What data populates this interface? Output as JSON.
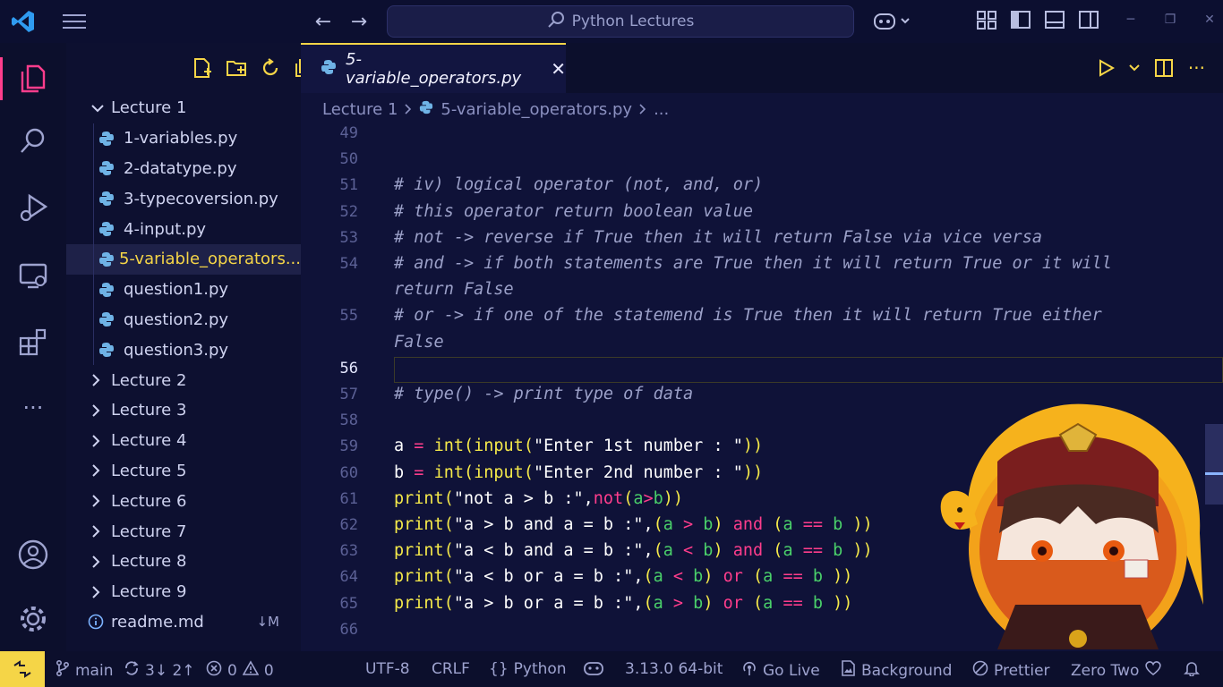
{
  "window": {
    "search_text": "Python Lectures"
  },
  "explorer": {
    "tree": [
      {
        "label": "Lecture 1",
        "kind": "folder",
        "open": true
      },
      {
        "label": "1-variables.py",
        "kind": "file"
      },
      {
        "label": "2-datatype.py",
        "kind": "file"
      },
      {
        "label": "3-typecoversion.py",
        "kind": "file"
      },
      {
        "label": "4-input.py",
        "kind": "file"
      },
      {
        "label": "5-variable_operators...",
        "kind": "file",
        "active": true
      },
      {
        "label": "question1.py",
        "kind": "file"
      },
      {
        "label": "question2.py",
        "kind": "file"
      },
      {
        "label": "question3.py",
        "kind": "file"
      },
      {
        "label": "Lecture 2",
        "kind": "folder"
      },
      {
        "label": "Lecture 3",
        "kind": "folder"
      },
      {
        "label": "Lecture 4",
        "kind": "folder"
      },
      {
        "label": "Lecture 5",
        "kind": "folder"
      },
      {
        "label": "Lecture 6",
        "kind": "folder"
      },
      {
        "label": "Lecture 7",
        "kind": "folder"
      },
      {
        "label": "Lecture 8",
        "kind": "folder"
      },
      {
        "label": "Lecture 9",
        "kind": "folder"
      },
      {
        "label": "readme.md",
        "kind": "readme",
        "badge": "↓M"
      }
    ]
  },
  "editor": {
    "tab_label": "5-variable_operators.py",
    "breadcrumb": [
      "Lecture 1",
      "5-variable_operators.py",
      "..."
    ],
    "line_numbers": [
      "49",
      "50",
      "51",
      "52",
      "53",
      "54",
      "",
      "55",
      "",
      "56",
      "57",
      "58",
      "59",
      "60",
      "61",
      "62",
      "63",
      "64",
      "65",
      "66"
    ],
    "comments": {
      "l51": "# iv) logical operator (not, and, or)",
      "l52": "# this operator return boolean value",
      "l53": "# not -> reverse if True then it will return False via vice versa",
      "l54a": "# and -> if both statements are True then it will return True or it will",
      "l54b": "return False",
      "l55a": "# or -> if one of the statemend is True then it will return True either",
      "l55b": "False",
      "l57": "# type() -> print type of data"
    },
    "strings": {
      "s59": "\"Enter 1st number : \"",
      "s60": "\"Enter 2nd number : \"",
      "s61": "\"not a > b :\"",
      "s62": "\"a > b and a = b :\"",
      "s63": "\"a < b and a = b :\"",
      "s64": "\"a < b or a = b :\"",
      "s65": "\"a > b or a = b :\""
    }
  },
  "statusbar": {
    "branch": "main",
    "sync": "3↓ 2↑",
    "errors": "0",
    "warnings": "0",
    "encoding": "UTF-8",
    "eol": "CRLF",
    "language": "Python",
    "interpreter": "3.13.0 64-bit",
    "golive": "Go Live",
    "background": "Background",
    "prettier": "Prettier",
    "theme": "Zero Two"
  },
  "colors": {
    "accent": "#f5d547",
    "activity_active": "#ff3d8c",
    "background": "#0f1238"
  }
}
